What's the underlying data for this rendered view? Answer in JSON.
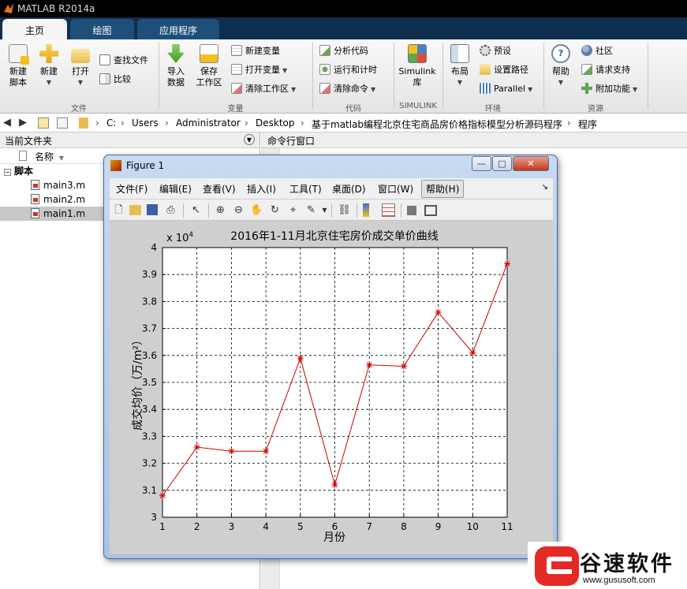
{
  "app": {
    "title": "MATLAB R2014a"
  },
  "tabs": [
    {
      "label": "主页"
    },
    {
      "label": "绘图"
    },
    {
      "label": "应用程序"
    }
  ],
  "ribbon": {
    "file_group": {
      "new_script": "新建\n脚本",
      "new": "新建",
      "open": "打开",
      "find_files": "查找文件",
      "compare": "比较",
      "label": "文件"
    },
    "variable_group": {
      "import": "导入\n数据",
      "save_workspace": "保存\n工作区",
      "new_variable": "新建变量",
      "open_variable": "打开变量",
      "clear_workspace": "清除工作区",
      "label": "变量"
    },
    "code_group": {
      "analyze": "分析代码",
      "run_time": "运行和计时",
      "clear_commands": "清除命令",
      "label": "代码"
    },
    "simulink_group": {
      "simulink": "Simulink\n库",
      "label": "SIMULINK"
    },
    "env_group": {
      "layout": "布局",
      "preferences": "预设",
      "set_path": "设置路径",
      "parallel": "Parallel",
      "label": "环境"
    },
    "resources_group": {
      "help": "帮助",
      "community": "社区",
      "request_support": "请求支持",
      "addons": "附加功能",
      "label": "资源"
    }
  },
  "address": {
    "crumbs": [
      "C:",
      "Users",
      "Administrator",
      "Desktop",
      "基于matlab编程北京住宅商品房价格指标模型分析源码程序",
      "程序"
    ]
  },
  "current_folder": {
    "title": "当前文件夹",
    "column_name": "名称",
    "group": "脚本",
    "files": [
      "main3.m",
      "main2.m",
      "main1.m"
    ]
  },
  "command_window": {
    "title": "命令行窗口"
  },
  "figure": {
    "title": "Figure 1",
    "menu": [
      "文件(F)",
      "编辑(E)",
      "查看(V)",
      "插入(I)",
      "工具(T)",
      "桌面(D)",
      "窗口(W)",
      "帮助(H)"
    ],
    "buttons": {
      "minimize": "—",
      "maximize": "□",
      "close": "✕"
    }
  },
  "watermark": {
    "brand": "谷速软件",
    "url": "www.gususoft.com"
  },
  "chart_data": {
    "type": "line",
    "title": "2016年1-11月北京住宅房价成交单价曲线",
    "xlabel": "月份",
    "ylabel": "成交均价（万/m²）",
    "y_multiplier": "x 10",
    "y_multiplier_exp": "4",
    "x": [
      1,
      2,
      3,
      4,
      5,
      6,
      7,
      8,
      9,
      10,
      11
    ],
    "values": [
      3.08,
      3.26,
      3.245,
      3.245,
      3.59,
      3.12,
      3.565,
      3.56,
      3.76,
      3.61,
      3.94
    ],
    "xlim": [
      1,
      11
    ],
    "ylim": [
      3,
      4
    ],
    "xticks": [
      "1",
      "2",
      "3",
      "4",
      "5",
      "6",
      "7",
      "8",
      "9",
      "10",
      "11"
    ],
    "yticks": [
      "3",
      "3.1",
      "3.2",
      "3.3",
      "3.4",
      "3.5",
      "3.6",
      "3.7",
      "3.8",
      "3.9",
      "4"
    ],
    "grid": true,
    "line_color": "#cc0000",
    "marker": "*"
  }
}
